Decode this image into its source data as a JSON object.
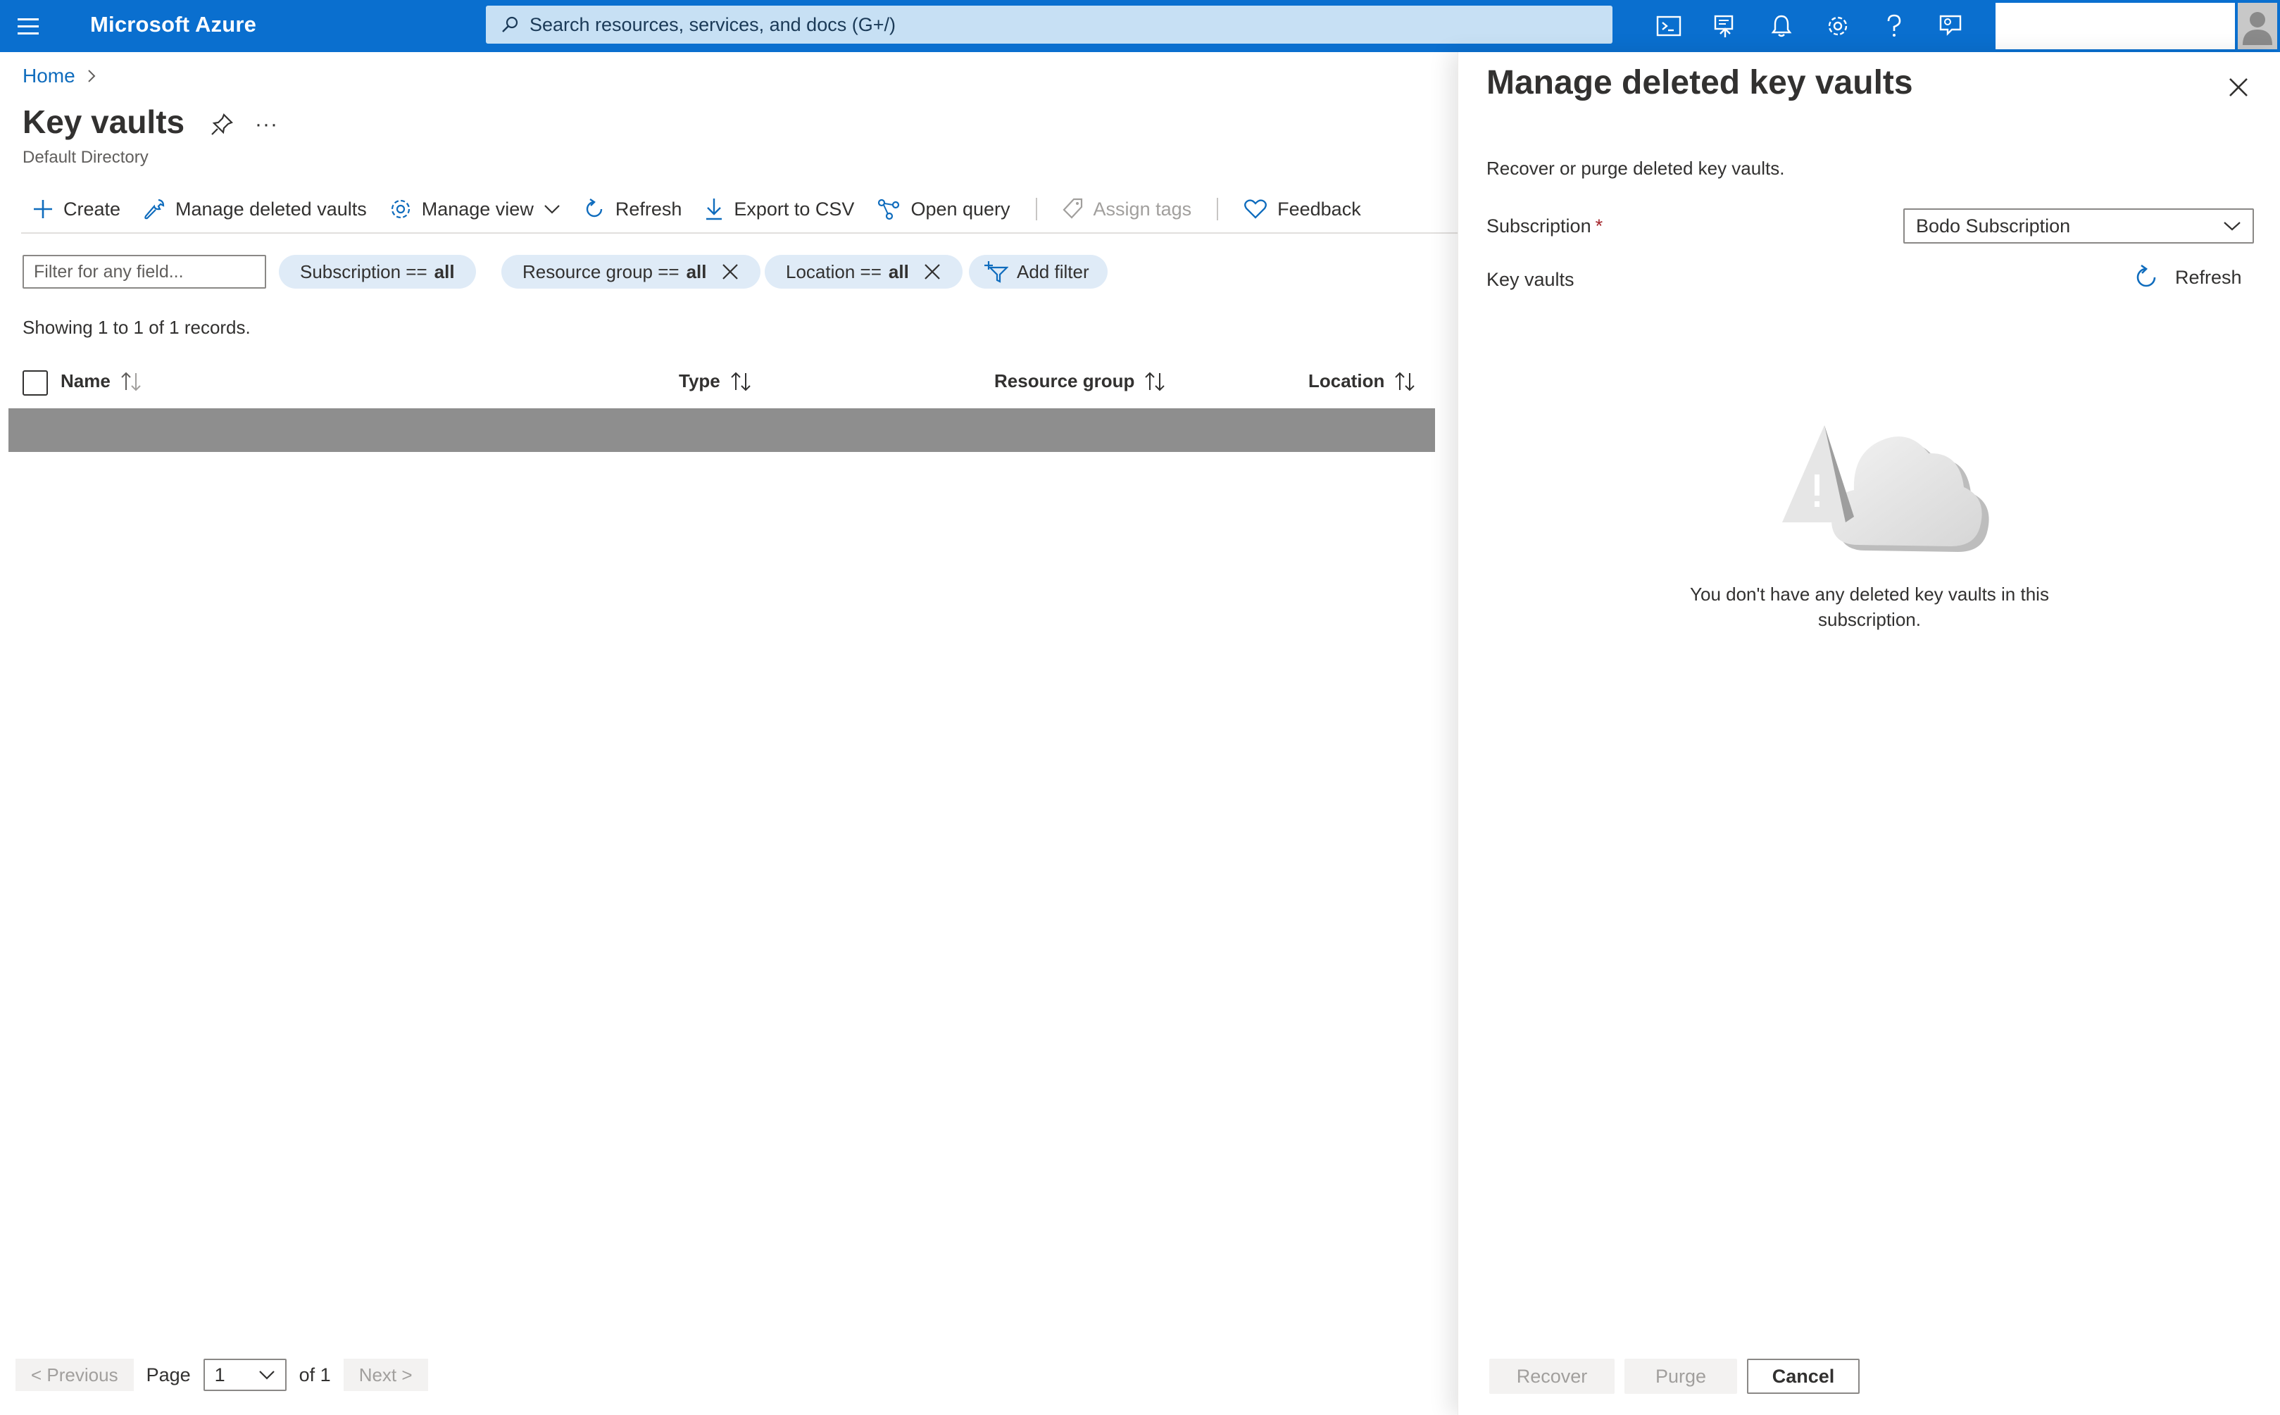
{
  "topbar": {
    "brand": "Microsoft Azure",
    "search_placeholder": "Search resources, services, and docs (G+/)",
    "bg_color": "#0a6fcf"
  },
  "breadcrumb": {
    "home": "Home"
  },
  "page": {
    "title": "Key vaults",
    "subtitle": "Default Directory",
    "more": "···"
  },
  "toolbar": {
    "create": "Create",
    "manage_deleted": "Manage deleted vaults",
    "manage_view": "Manage view",
    "refresh": "Refresh",
    "export_csv": "Export to CSV",
    "open_query": "Open query",
    "assign_tags": "Assign tags",
    "feedback": "Feedback"
  },
  "filters": {
    "placeholder": "Filter for any field...",
    "subscription_label": "Subscription ==",
    "subscription_value": "all",
    "resource_group_label": "Resource group ==",
    "resource_group_value": "all",
    "location_label": "Location ==",
    "location_value": "all",
    "add_filter": "Add filter"
  },
  "table": {
    "showing": "Showing 1 to 1 of 1 records.",
    "columns": {
      "name": "Name",
      "type": "Type",
      "resource_group": "Resource group",
      "location": "Location"
    }
  },
  "pager": {
    "previous": "< Previous",
    "page_label": "Page",
    "page_value": "1",
    "of_label": "of 1",
    "next": "Next >"
  },
  "panel": {
    "title": "Manage deleted key vaults",
    "description": "Recover or purge deleted key vaults.",
    "subscription_label": "Subscription",
    "required_mark": "*",
    "subscription_value": "Bodo Subscription",
    "key_vaults_label": "Key vaults",
    "refresh": "Refresh",
    "empty_message": "You don't have any deleted key vaults in this subscription.",
    "recover": "Recover",
    "purge": "Purge",
    "cancel": "Cancel"
  },
  "icons": {
    "menu": "hamburger-icon",
    "search": "search-icon",
    "cloud_shell": "cloud-shell-icon",
    "directory_filter": "directory-filter-icon",
    "notifications": "bell-icon",
    "settings": "gear-icon",
    "help": "help-icon",
    "feedback": "feedback-person-icon"
  }
}
